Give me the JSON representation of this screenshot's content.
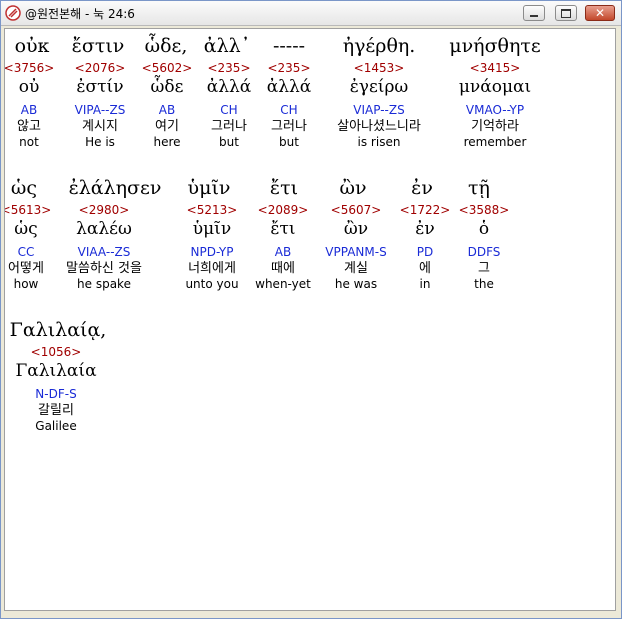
{
  "window": {
    "title": "@원전본해 - 눅 24:6"
  },
  "rows": [
    [
      {
        "greek": "οὐκ",
        "strong": "<3756>",
        "lemma": "οὐ",
        "parse": "AB",
        "korean": "않고",
        "english": "not"
      },
      {
        "greek": "ἔστιν",
        "strong": "<2076>",
        "lemma": "ἐστίν",
        "parse": "VIPA--ZS",
        "korean": "계시지",
        "english": "He is"
      },
      {
        "greek": "ὧδε,",
        "strong": "<5602>",
        "lemma": "ὧδε",
        "parse": "AB",
        "korean": "여기",
        "english": "here"
      },
      {
        "greek": "ἀλλ᾽",
        "strong": "<235>",
        "lemma": "ἀλλά",
        "parse": "CH",
        "korean": "그러나",
        "english": "but"
      },
      {
        "greek": "-----",
        "strong": "<235>",
        "lemma": "ἀλλά",
        "parse": "CH",
        "korean": "그러나",
        "english": "but"
      },
      {
        "greek": "ἠγέρθη.",
        "strong": "<1453>",
        "lemma": "ἐγείρω",
        "parse": "VIAP--ZS",
        "korean": "살아나셨느니라",
        "english": "is risen"
      },
      {
        "greek": "μνήσθητε",
        "strong": "<3415>",
        "lemma": "μνάομαι",
        "parse": "VMAO--YP",
        "korean": "기억하라",
        "english": "remember"
      }
    ],
    [
      {
        "greek": "ὡς",
        "strong": "<5613>",
        "lemma": "ὡς",
        "parse": "CC",
        "korean": "어떻게",
        "english": "how"
      },
      {
        "greek": "ἐλάλησεν",
        "strong": "<2980>",
        "lemma": "λαλέω",
        "parse": "VIAA--ZS",
        "korean": "말씀하신 것을",
        "english": "he spake"
      },
      {
        "greek": "ὑμῖν",
        "strong": "<5213>",
        "lemma": "ὑμῖν",
        "parse": "NPD-YP",
        "korean": "너희에게",
        "english": "unto you"
      },
      {
        "greek": "ἔτι",
        "strong": "<2089>",
        "lemma": "ἔτι",
        "parse": "AB",
        "korean": "때에",
        "english": "when-yet"
      },
      {
        "greek": "ὢν",
        "strong": "<5607>",
        "lemma": "ὢν",
        "parse": "VPPANM-S",
        "korean": "계실",
        "english": "he was"
      },
      {
        "greek": "ἐν",
        "strong": "<1722>",
        "lemma": "ἐν",
        "parse": "PD",
        "korean": "에",
        "english": "in"
      },
      {
        "greek": "τῇ",
        "strong": "<3588>",
        "lemma": "ὁ",
        "parse": "DDFS",
        "korean": "그",
        "english": "the"
      }
    ],
    [
      {
        "greek": "Γαλιλαίᾳ,",
        "strong": "<1056>",
        "lemma": "Γαλιλαία",
        "parse": "N-DF-S",
        "korean": "갈릴리",
        "english": "Galilee"
      }
    ]
  ]
}
